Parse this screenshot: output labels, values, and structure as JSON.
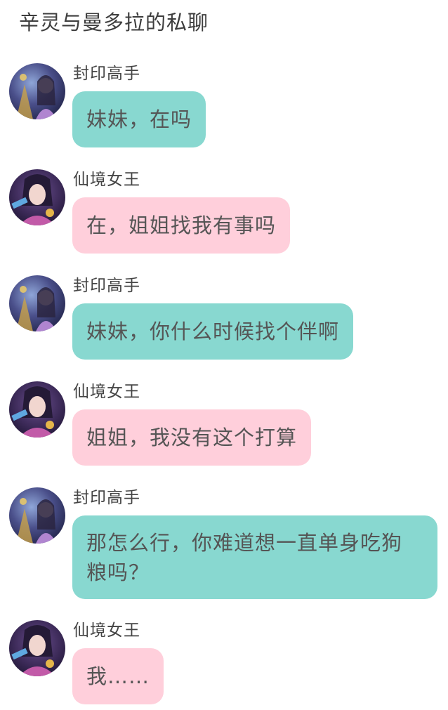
{
  "header": {
    "title": "辛灵与曼多拉的私聊"
  },
  "colors": {
    "teal_bubble": "#88d8d0",
    "pink_bubble": "#ffcfdb"
  },
  "messages": [
    {
      "sender": "封印高手",
      "text": "妹妹，在吗",
      "avatar": "sealing-master-avatar",
      "bubble_color": "teal"
    },
    {
      "sender": "仙境女王",
      "text": "在，姐姐找我有事吗",
      "avatar": "fairyland-queen-avatar",
      "bubble_color": "pink"
    },
    {
      "sender": "封印高手",
      "text": "妹妹，你什么时候找个伴啊",
      "avatar": "sealing-master-avatar",
      "bubble_color": "teal"
    },
    {
      "sender": "仙境女王",
      "text": "姐姐，我没有这个打算",
      "avatar": "fairyland-queen-avatar",
      "bubble_color": "pink"
    },
    {
      "sender": "封印高手",
      "text": "那怎么行，你难道想一直单身吃狗\n粮吗？",
      "avatar": "sealing-master-avatar",
      "bubble_color": "teal"
    },
    {
      "sender": "仙境女王",
      "text": "我……",
      "avatar": "fairyland-queen-avatar",
      "bubble_color": "pink"
    }
  ]
}
